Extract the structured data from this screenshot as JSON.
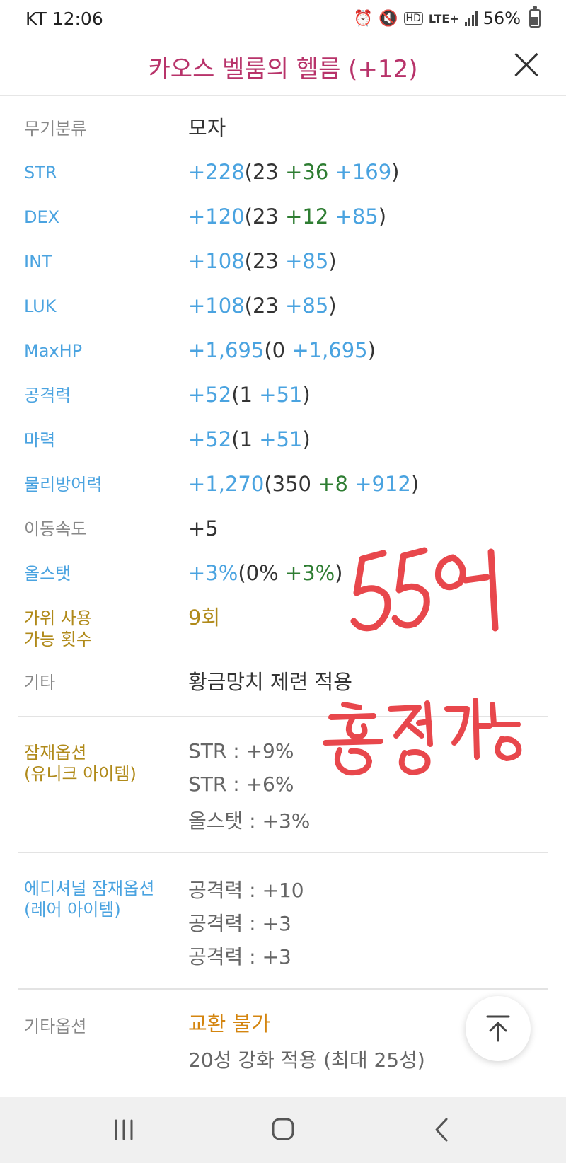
{
  "status_bar": {
    "carrier": "KT",
    "time": "12:06",
    "network": "LTE+",
    "battery": "56%",
    "icons": [
      "alarm-icon",
      "mute-icon",
      "hd-voice-icon",
      "lte-icon",
      "signal-icon",
      "battery-icon"
    ]
  },
  "header": {
    "title": "카오스 벨룸의 헬름 (+12)",
    "title_color": "#b8336a"
  },
  "stats": [
    {
      "label": "무기분류",
      "parts": [
        [
          "모자",
          "n"
        ]
      ]
    },
    {
      "label": "STR",
      "parts": [
        [
          "+228",
          "b"
        ],
        [
          "(23 ",
          "n"
        ],
        [
          "+36",
          "g"
        ],
        [
          " ",
          "n"
        ],
        [
          "+169",
          "b"
        ],
        [
          ")",
          "n"
        ]
      ]
    },
    {
      "label": "DEX",
      "parts": [
        [
          "+120",
          "b"
        ],
        [
          "(23 ",
          "n"
        ],
        [
          "+12",
          "g"
        ],
        [
          " ",
          "n"
        ],
        [
          "+85",
          "b"
        ],
        [
          ")",
          "n"
        ]
      ]
    },
    {
      "label": "INT",
      "parts": [
        [
          "+108",
          "b"
        ],
        [
          "(23 ",
          "n"
        ],
        [
          "+85",
          "b"
        ],
        [
          ")",
          "n"
        ]
      ]
    },
    {
      "label": "LUK",
      "parts": [
        [
          "+108",
          "b"
        ],
        [
          "(23 ",
          "n"
        ],
        [
          "+85",
          "b"
        ],
        [
          ")",
          "n"
        ]
      ]
    },
    {
      "label": "MaxHP",
      "parts": [
        [
          "+1,695",
          "b"
        ],
        [
          "(0 ",
          "n"
        ],
        [
          "+1,695",
          "b"
        ],
        [
          ")",
          "n"
        ]
      ]
    },
    {
      "label": "공격력",
      "parts": [
        [
          "+52",
          "b"
        ],
        [
          "(1 ",
          "n"
        ],
        [
          "+51",
          "b"
        ],
        [
          ")",
          "n"
        ]
      ]
    },
    {
      "label": "마력",
      "parts": [
        [
          "+52",
          "b"
        ],
        [
          "(1 ",
          "n"
        ],
        [
          "+51",
          "b"
        ],
        [
          ")",
          "n"
        ]
      ]
    },
    {
      "label": "물리방어력",
      "parts": [
        [
          "+1,270",
          "b"
        ],
        [
          "(350 ",
          "n"
        ],
        [
          "+8",
          "g"
        ],
        [
          " ",
          "n"
        ],
        [
          "+912",
          "b"
        ],
        [
          ")",
          "n"
        ]
      ]
    },
    {
      "label": "이동속도",
      "parts": [
        [
          "+5",
          "n"
        ]
      ]
    },
    {
      "label": "올스탯",
      "parts": [
        [
          "+3%",
          "b"
        ],
        [
          "(0% ",
          "n"
        ],
        [
          "+3%",
          "g"
        ],
        [
          ")",
          "n"
        ]
      ]
    },
    {
      "label": "가위 사용\n가능 횟수",
      "parts": [
        [
          "9회",
          "o"
        ]
      ]
    },
    {
      "label": "기타",
      "parts": [
        [
          "황금망치 제련 적용",
          "n"
        ]
      ]
    }
  ],
  "potential": {
    "label_line1": "잠재옵션",
    "label_line2": "(유니크 아이템)",
    "lines": [
      "STR : +9%",
      "STR : +6%",
      "올스탯 : +3%"
    ]
  },
  "additional_potential": {
    "label_line1": "에디셔널 잠재옵션",
    "label_line2": "(레어 아이템)",
    "lines": [
      "공격력 : +10",
      "공격력 : +3",
      "공격력 : +3"
    ]
  },
  "other_options": {
    "label": "기타옵션",
    "trade": "교환 불가",
    "starforce": "20성 강화 적용 (최대 25성)"
  },
  "colors": {
    "blue": "#4aa3e0",
    "green": "#2e7d32",
    "gold": "#b08a1a",
    "orange": "#d4850f",
    "scribble_red": "#e8474c"
  },
  "scroll_top_icon": "arrow-up-to-top-icon",
  "nav": [
    "recent-apps-icon",
    "home-icon",
    "back-icon"
  ]
}
